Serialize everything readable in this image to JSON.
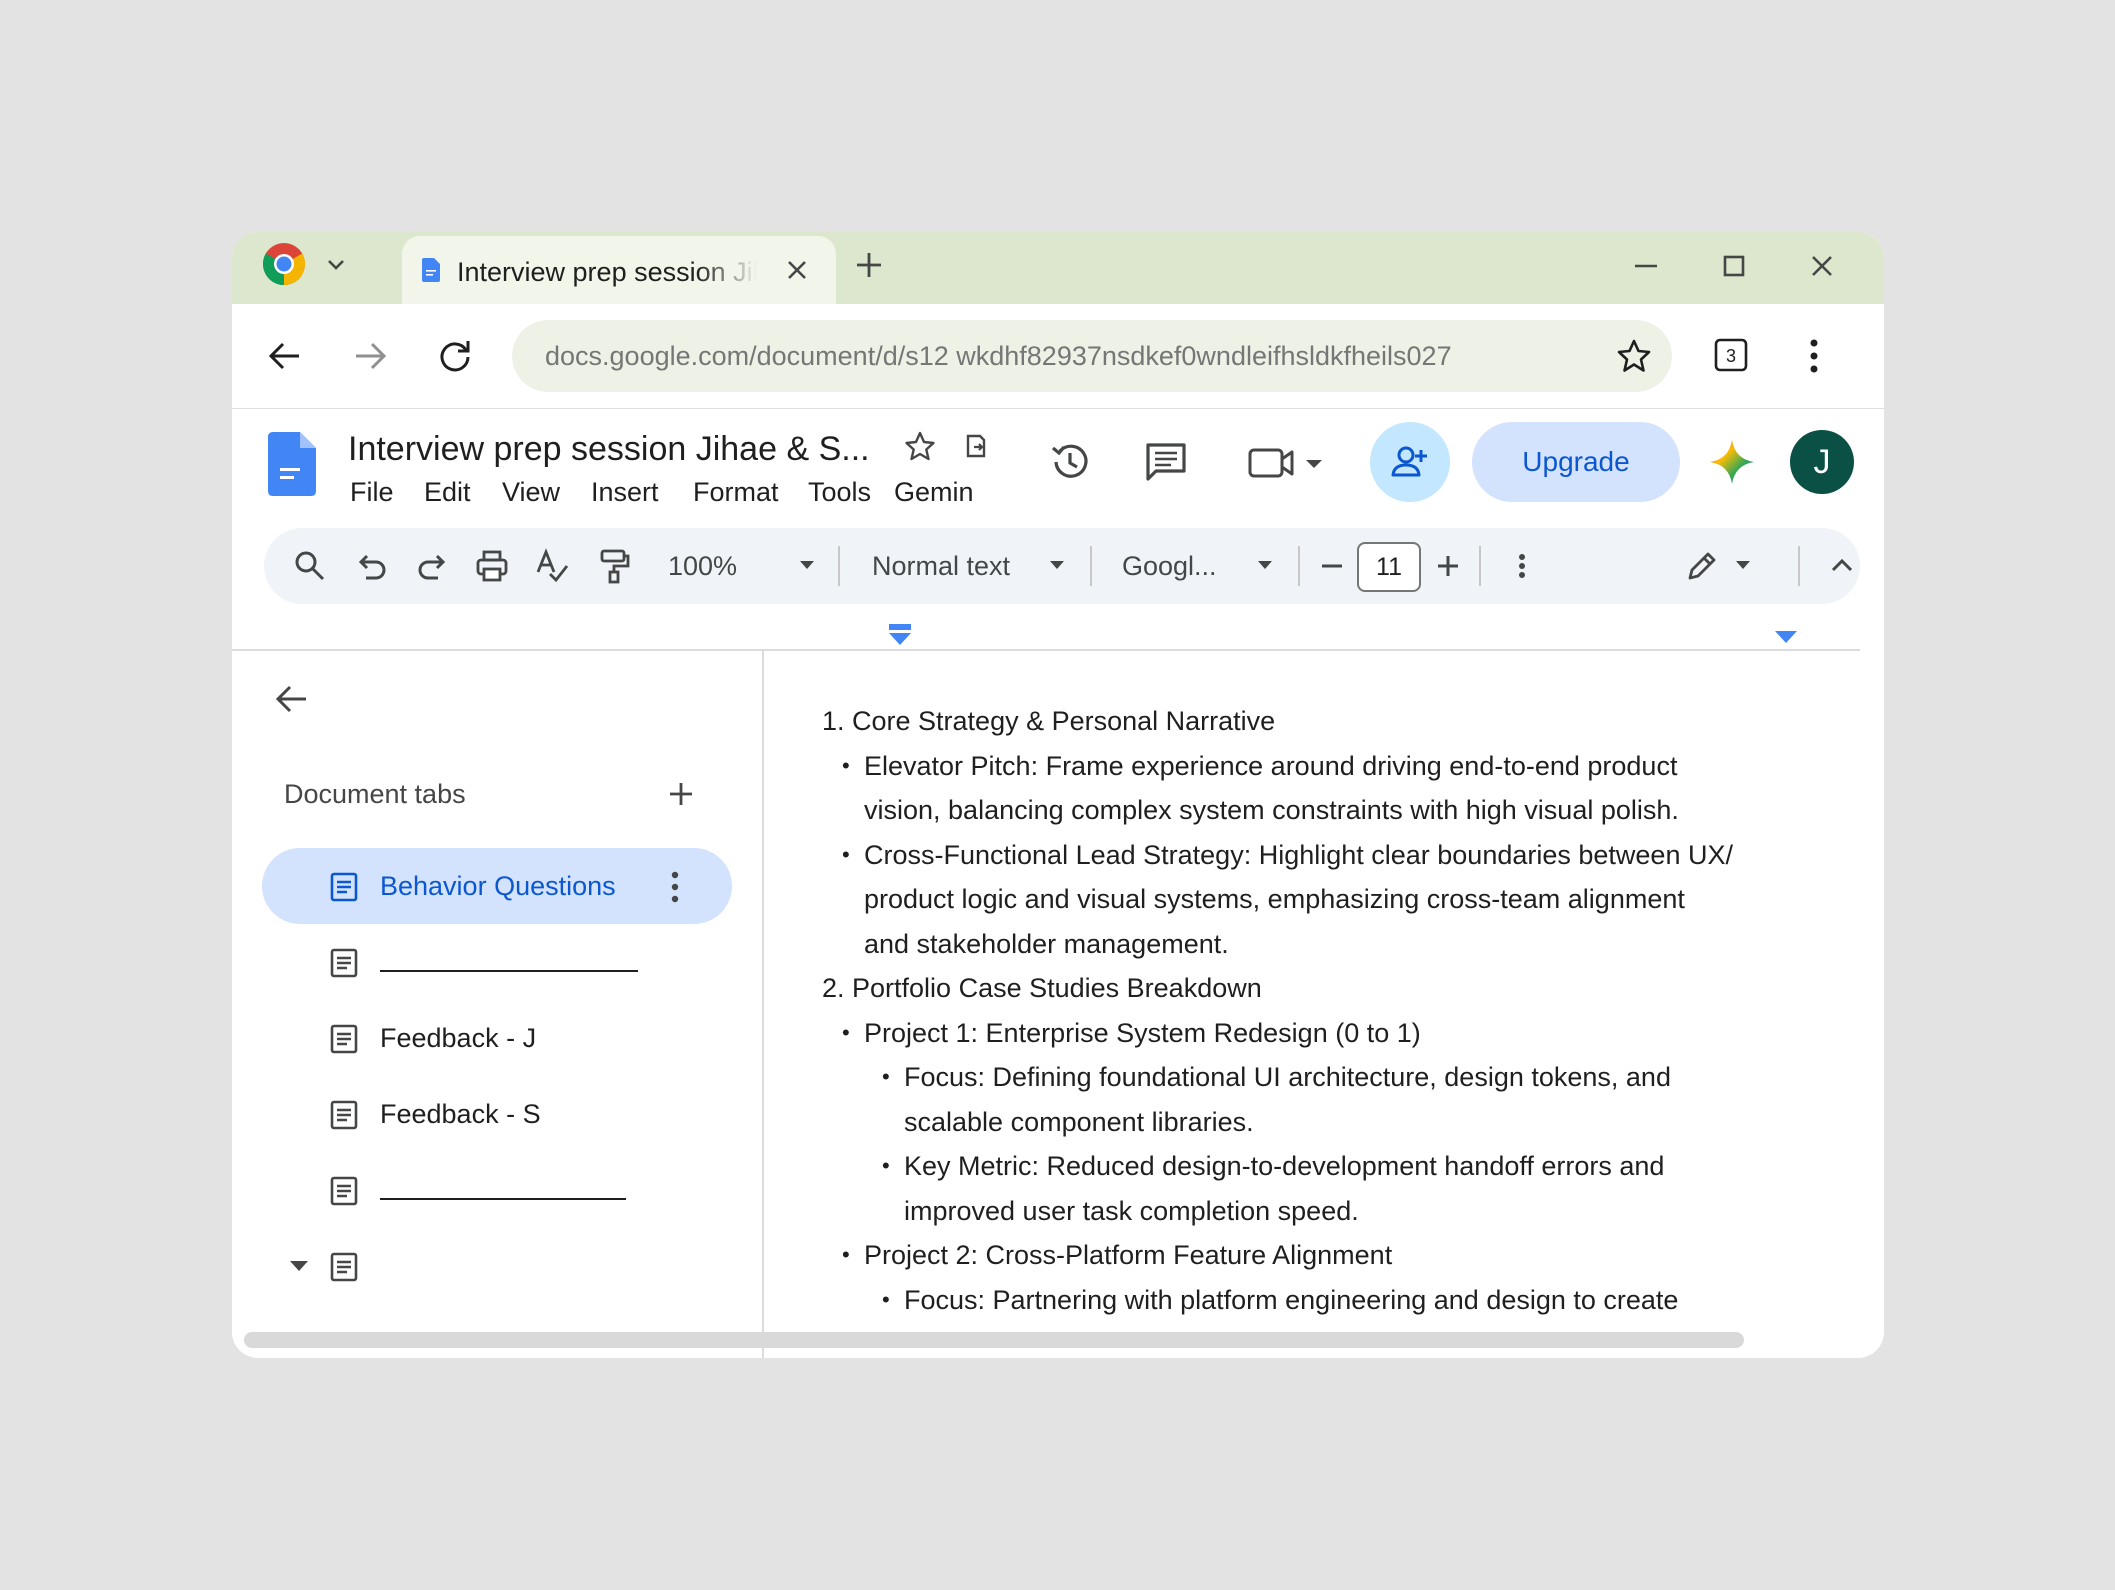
{
  "browser": {
    "tab_title": "Interview prep session Jihae & S",
    "url": "docs.google.com/document/d/s12 wkdhf82937nsdkef0wndleifhsldkfheils027",
    "tab_count": "3"
  },
  "docs": {
    "title": "Interview prep session Jihae & S...",
    "menu": [
      "File",
      "Edit",
      "View",
      "Insert",
      "Format",
      "Tools",
      "Gemini"
    ],
    "upgrade_label": "Upgrade",
    "avatar_initial": "J"
  },
  "toolbar": {
    "zoom": "100%",
    "style": "Normal text",
    "font": "Googl...",
    "font_size": "11"
  },
  "sidebar": {
    "heading": "Document tabs",
    "items": [
      {
        "label": "Behavior Questions",
        "active": true
      },
      {
        "label": "",
        "placeholder_line": true
      },
      {
        "label": "Feedback - J"
      },
      {
        "label": "Feedback - S"
      },
      {
        "label": "",
        "placeholder_line": true
      },
      {
        "label": "",
        "collapsed": true
      }
    ]
  },
  "document": {
    "lines": [
      {
        "text": "1. Core Strategy & Personal Narrative",
        "level": 0
      },
      {
        "text": "Elevator Pitch: Frame experience around driving end-to-end product",
        "level": 1,
        "bullet": true
      },
      {
        "text": "vision, balancing complex system constraints with high visual polish.",
        "level": 1
      },
      {
        "text": "Cross-Functional Lead Strategy: Highlight clear boundaries between UX/",
        "level": 1,
        "bullet": true
      },
      {
        "text": "product logic and visual systems, emphasizing cross-team alignment",
        "level": 1
      },
      {
        "text": "and stakeholder management.",
        "level": 1
      },
      {
        "text": "2. Portfolio Case Studies Breakdown",
        "level": 0
      },
      {
        "text": "Project 1: Enterprise System Redesign (0 to 1)",
        "level": 1,
        "bullet": true
      },
      {
        "text": "Focus: Defining foundational UI architecture, design tokens, and",
        "level": 2,
        "bullet": true
      },
      {
        "text": "scalable component libraries.",
        "level": 2
      },
      {
        "text": "Key Metric: Reduced design-to-development handoff errors and",
        "level": 2,
        "bullet": true
      },
      {
        "text": "improved user task completion speed.",
        "level": 2
      },
      {
        "text": "Project 2: Cross-Platform Feature Alignment",
        "level": 1,
        "bullet": true
      },
      {
        "text": "Focus: Partnering with platform engineering and design to create",
        "level": 2,
        "bullet": true,
        "clipped": true
      }
    ]
  },
  "colors": {
    "tabstrip": "#dde7cd",
    "accent_blue": "#0b57d0",
    "active_tab_bg": "#d3e3fd",
    "share_bg": "#c2e7ff",
    "avatar_bg": "#0a5044"
  }
}
